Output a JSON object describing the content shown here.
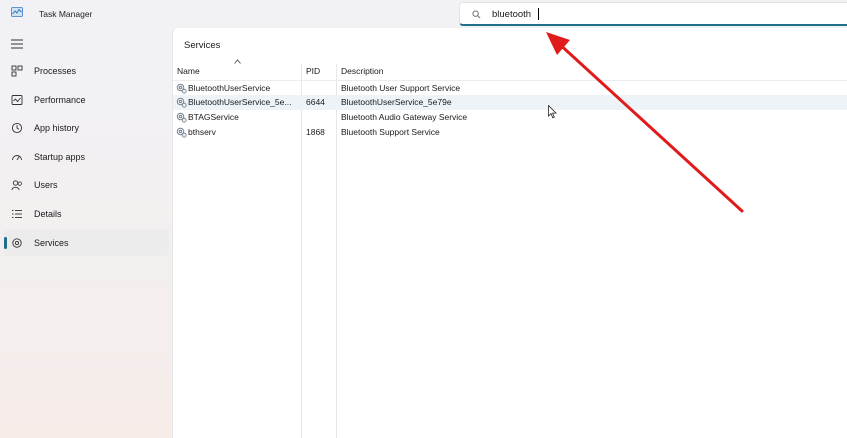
{
  "window": {
    "title": "Task Manager"
  },
  "search": {
    "value": "bluetooth",
    "icon": "search-icon"
  },
  "sidebar": {
    "items": [
      {
        "label": "Processes",
        "icon": "processes-icon",
        "active": false
      },
      {
        "label": "Performance",
        "icon": "performance-icon",
        "active": false
      },
      {
        "label": "App history",
        "icon": "app-history-icon",
        "active": false
      },
      {
        "label": "Startup apps",
        "icon": "startup-apps-icon",
        "active": false
      },
      {
        "label": "Users",
        "icon": "users-icon",
        "active": false
      },
      {
        "label": "Details",
        "icon": "details-icon",
        "active": false
      },
      {
        "label": "Services",
        "icon": "services-icon",
        "active": true
      }
    ]
  },
  "main": {
    "title": "Services",
    "columns": {
      "name": "Name",
      "pid": "PID",
      "description": "Description"
    },
    "rows": [
      {
        "name": "BluetoothUserService",
        "pid": "",
        "description": "Bluetooth User Support Service",
        "selected": false
      },
      {
        "name": "BluetoothUserService_5e...",
        "pid": "6644",
        "description": "BluetoothUserService_5e79e",
        "selected": true
      },
      {
        "name": "BTAGService",
        "pid": "",
        "description": "Bluetooth Audio Gateway Service",
        "selected": false
      },
      {
        "name": "bthserv",
        "pid": "1868",
        "description": "Bluetooth Support Service",
        "selected": false
      }
    ]
  },
  "colors": {
    "accent": "#1f6f8b",
    "annotation_arrow": "#e01b1b",
    "selection": "#eef3f8"
  }
}
